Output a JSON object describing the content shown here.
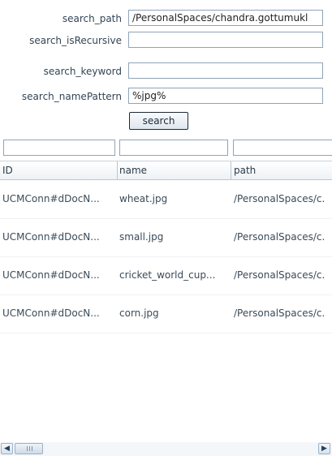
{
  "form": {
    "search_path": {
      "label": "search_path",
      "value": "/PersonalSpaces/chandra.gottumukl"
    },
    "search_isRecursive": {
      "label": "search_isRecursive",
      "value": ""
    },
    "search_keyword": {
      "label": "search_keyword",
      "value": ""
    },
    "search_namePattern": {
      "label": "search_namePattern",
      "value": "%jpg%"
    },
    "search_button_label": "search"
  },
  "table": {
    "columns": [
      "ID",
      "name",
      "path"
    ],
    "rows": [
      {
        "id": "UCMConn#dDocN...",
        "name": "wheat.jpg",
        "path": "/PersonalSpaces/c."
      },
      {
        "id": "UCMConn#dDocN...",
        "name": "small.jpg",
        "path": "/PersonalSpaces/c."
      },
      {
        "id": "UCMConn#dDocN...",
        "name": "cricket_world_cup...",
        "path": "/PersonalSpaces/c."
      },
      {
        "id": "UCMConn#dDocN...",
        "name": "corn.jpg",
        "path": "/PersonalSpaces/c."
      }
    ]
  },
  "scrollbar": {
    "left_icon": "chevron-left-icon",
    "right_icon": "chevron-right-icon"
  }
}
